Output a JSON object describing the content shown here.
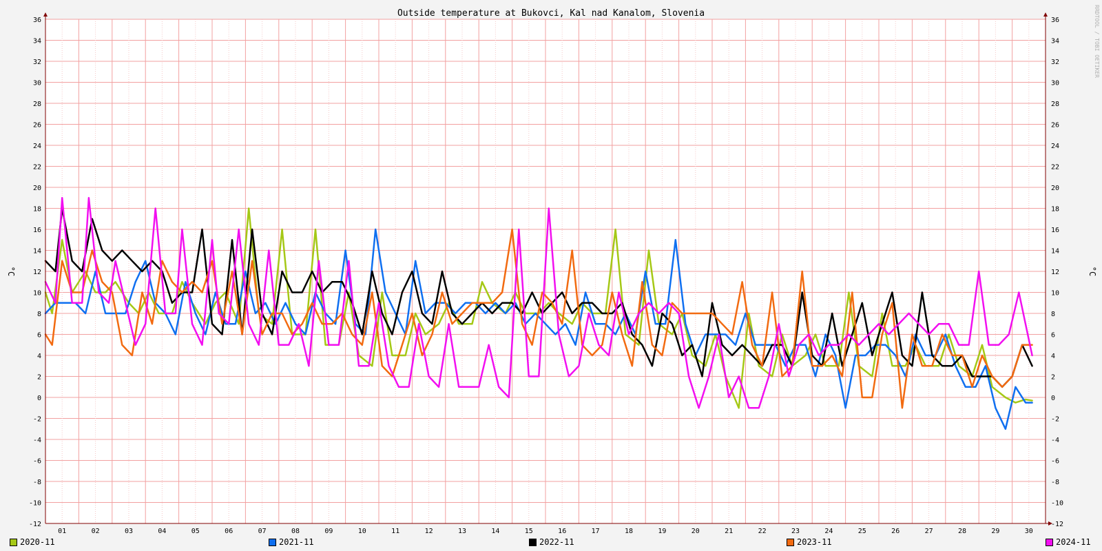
{
  "chart_data": {
    "type": "line",
    "title": "Outside temperature at Bukovci, Kal nad Kanalom, Slovenia",
    "ylabel": "°C",
    "ylabel_right": "°C",
    "watermark": "RRDTOOL / TOBI OETIKER",
    "ylim": [
      -12,
      36
    ],
    "yticks": [
      -12,
      -10,
      -8,
      -6,
      -4,
      -2,
      0,
      2,
      4,
      6,
      8,
      10,
      12,
      14,
      16,
      18,
      20,
      22,
      24,
      26,
      28,
      30,
      32,
      34,
      36
    ],
    "xlim": [
      1,
      31
    ],
    "xtick_labels": [
      "01",
      "02",
      "03",
      "04",
      "05",
      "06",
      "07",
      "08",
      "09",
      "10",
      "11",
      "12",
      "13",
      "14",
      "15",
      "16",
      "17",
      "18",
      "19",
      "20",
      "21",
      "22",
      "23",
      "24",
      "25",
      "26",
      "27",
      "28",
      "29",
      "30"
    ],
    "grid": true,
    "legend_position": "bottom",
    "series": [
      {
        "name": "2020-11",
        "color": "#a5c816",
        "x": [
          1,
          1.2,
          1.5,
          1.8,
          2.2,
          2.5,
          2.8,
          3.1,
          3.5,
          3.8,
          4.1,
          4.4,
          4.8,
          5.1,
          5.4,
          5.8,
          6.1,
          6.4,
          6.8,
          7.1,
          7.4,
          7.8,
          8.1,
          8.4,
          8.8,
          9.1,
          9.4,
          9.8,
          10.1,
          10.4,
          10.8,
          11.1,
          11.4,
          11.8,
          12.1,
          12.4,
          12.8,
          13.1,
          13.4,
          13.8,
          14.1,
          14.4,
          14.8,
          15.1,
          15.4,
          15.8,
          16.1,
          16.4,
          16.8,
          17.1,
          17.4,
          17.8,
          18.1,
          18.4,
          18.8,
          19.1,
          19.4,
          19.8,
          20.1,
          20.4,
          20.8,
          21.1,
          21.4,
          21.8,
          22.1,
          22.4,
          22.8,
          23.1,
          23.4,
          23.8,
          24.1,
          24.4,
          24.8,
          25.1,
          25.4,
          25.8,
          26.1,
          26.4,
          26.8,
          27.1,
          27.4,
          27.8,
          28.1,
          28.4,
          28.8,
          29.1,
          29.4,
          29.8,
          30.1,
          30.4,
          30.6
        ],
        "y": [
          10,
          8,
          15,
          10,
          12,
          10,
          10,
          11,
          9,
          8,
          10,
          8,
          8,
          11,
          9,
          7,
          9,
          10,
          7,
          18,
          8,
          7,
          16,
          6,
          6,
          16,
          5,
          5,
          10,
          4,
          3,
          10,
          4,
          4,
          8,
          6,
          7,
          9,
          7,
          7,
          11,
          9,
          8,
          10,
          8,
          8,
          9,
          8,
          7,
          9,
          8,
          8,
          16,
          6,
          5,
          14,
          7,
          6,
          8,
          4,
          3,
          6,
          2,
          -1,
          8,
          3,
          2,
          6,
          3,
          4,
          6,
          3,
          3,
          10,
          3,
          2,
          8,
          3,
          3,
          5,
          3,
          3,
          6,
          3,
          2,
          5,
          1,
          0,
          -0.5,
          -0.2,
          -0.3
        ]
      },
      {
        "name": "2021-11",
        "color": "#0f6ff0",
        "x": [
          1,
          1.3,
          1.6,
          1.9,
          2.2,
          2.5,
          2.8,
          3.1,
          3.4,
          3.7,
          4.0,
          4.3,
          4.6,
          4.9,
          5.2,
          5.5,
          5.8,
          6.1,
          6.4,
          6.7,
          7.0,
          7.3,
          7.6,
          7.9,
          8.2,
          8.5,
          8.8,
          9.1,
          9.4,
          9.7,
          10.0,
          10.3,
          10.6,
          10.9,
          11.2,
          11.5,
          11.8,
          12.1,
          12.4,
          12.7,
          13.0,
          13.3,
          13.6,
          13.9,
          14.2,
          14.5,
          14.8,
          15.1,
          15.4,
          15.7,
          16.0,
          16.3,
          16.6,
          16.9,
          17.2,
          17.5,
          17.8,
          18.1,
          18.4,
          18.7,
          19.0,
          19.3,
          19.6,
          19.9,
          20.2,
          20.5,
          20.8,
          21.1,
          21.4,
          21.7,
          22.0,
          22.3,
          22.6,
          22.9,
          23.2,
          23.5,
          23.8,
          24.1,
          24.4,
          24.7,
          25.0,
          25.3,
          25.6,
          25.9,
          26.2,
          26.5,
          26.8,
          27.1,
          27.4,
          27.7,
          28.0,
          28.3,
          28.6,
          28.9,
          29.2,
          29.5,
          29.8,
          30.1,
          30.4,
          30.6
        ],
        "y": [
          8,
          9,
          9,
          9,
          8,
          12,
          8,
          8,
          8,
          11,
          13,
          9,
          8,
          6,
          11,
          8,
          6,
          10,
          7,
          7,
          12,
          8,
          9,
          7,
          9,
          7,
          6,
          10,
          8,
          7,
          14,
          7,
          6,
          16,
          10,
          8,
          6,
          13,
          8,
          9,
          9,
          8,
          9,
          9,
          8,
          9,
          8,
          9,
          7,
          8,
          7,
          6,
          7,
          5,
          10,
          7,
          7,
          6,
          8,
          6,
          12,
          7,
          7,
          15,
          7,
          4,
          6,
          6,
          6,
          5,
          8,
          5,
          5,
          5,
          3,
          5,
          5,
          2,
          6,
          4,
          -1,
          4,
          4,
          5,
          5,
          4,
          2,
          6,
          4,
          4,
          6,
          3,
          1,
          1,
          3,
          -1,
          -3,
          1,
          -0.5,
          -0.5
        ]
      },
      {
        "name": "2022-11",
        "color": "#000000",
        "x": [
          1,
          1.3,
          1.5,
          1.8,
          2.1,
          2.4,
          2.7,
          3.0,
          3.3,
          3.6,
          3.9,
          4.2,
          4.5,
          4.8,
          5.1,
          5.4,
          5.7,
          6.0,
          6.3,
          6.6,
          6.9,
          7.2,
          7.5,
          7.8,
          8.1,
          8.4,
          8.7,
          9.0,
          9.3,
          9.6,
          9.9,
          10.2,
          10.5,
          10.8,
          11.1,
          11.4,
          11.7,
          12.0,
          12.3,
          12.6,
          12.9,
          13.2,
          13.5,
          13.8,
          14.1,
          14.4,
          14.7,
          15.0,
          15.3,
          15.6,
          15.9,
          16.2,
          16.5,
          16.8,
          17.1,
          17.4,
          17.7,
          18.0,
          18.3,
          18.6,
          18.9,
          19.2,
          19.5,
          19.8,
          20.1,
          20.4,
          20.7,
          21.0,
          21.3,
          21.6,
          21.9,
          22.2,
          22.5,
          22.8,
          23.1,
          23.4,
          23.7,
          24.0,
          24.3,
          24.6,
          24.9,
          25.2,
          25.5,
          25.8,
          26.1,
          26.4,
          26.7,
          27.0,
          27.3,
          27.6,
          27.9,
          28.2,
          28.5,
          28.8,
          29.1,
          29.4,
          29.7,
          30.0,
          30.3,
          30.6
        ],
        "y": [
          13,
          12,
          18,
          13,
          12,
          17,
          14,
          13,
          14,
          13,
          12,
          13,
          12,
          9,
          10,
          10,
          16,
          7,
          6,
          15,
          6,
          16,
          8,
          6,
          12,
          10,
          10,
          12,
          10,
          11,
          11,
          9,
          6,
          12,
          8,
          6,
          10,
          12,
          8,
          7,
          12,
          8,
          7,
          8,
          9,
          8,
          9,
          9,
          8,
          10,
          8,
          9,
          10,
          8,
          9,
          9,
          8,
          8,
          9,
          6,
          5,
          3,
          8,
          7,
          4,
          5,
          2,
          9,
          5,
          4,
          5,
          4,
          3,
          5,
          5,
          3,
          10,
          4,
          3,
          8,
          3,
          6,
          9,
          4,
          7,
          10,
          4,
          3,
          10,
          4,
          3,
          3,
          4,
          2,
          2,
          2,
          1,
          2,
          5,
          3
        ]
      },
      {
        "name": "2023-11",
        "color": "#f26a10",
        "x": [
          1,
          1.2,
          1.5,
          1.8,
          2.1,
          2.4,
          2.7,
          3.0,
          3.3,
          3.6,
          3.9,
          4.2,
          4.5,
          4.8,
          5.1,
          5.4,
          5.7,
          6.0,
          6.3,
          6.6,
          6.9,
          7.2,
          7.5,
          7.8,
          8.1,
          8.4,
          8.7,
          9.0,
          9.3,
          9.6,
          9.9,
          10.2,
          10.5,
          10.8,
          11.1,
          11.4,
          11.7,
          12.0,
          12.3,
          12.6,
          12.9,
          13.2,
          13.5,
          13.8,
          14.1,
          14.4,
          14.7,
          15.0,
          15.3,
          15.6,
          15.9,
          16.2,
          16.5,
          16.8,
          17.1,
          17.4,
          17.7,
          18.0,
          18.3,
          18.6,
          18.9,
          19.2,
          19.5,
          19.8,
          20.1,
          20.4,
          20.7,
          21.0,
          21.3,
          21.6,
          21.9,
          22.2,
          22.5,
          22.8,
          23.1,
          23.4,
          23.7,
          24.0,
          24.3,
          24.6,
          24.9,
          25.2,
          25.5,
          25.8,
          26.1,
          26.4,
          26.7,
          27.0,
          27.3,
          27.6,
          27.9,
          28.2,
          28.5,
          28.8,
          29.1,
          29.4,
          29.7,
          30.0,
          30.3,
          30.6
        ],
        "y": [
          6,
          5,
          13,
          10,
          10,
          14,
          11,
          10,
          5,
          4,
          10,
          7,
          13,
          11,
          10,
          11,
          10,
          13,
          7,
          12,
          6,
          13,
          6,
          8,
          8,
          6,
          7,
          9,
          7,
          7,
          8,
          6,
          5,
          10,
          3,
          2,
          5,
          8,
          4,
          6,
          10,
          7,
          8,
          9,
          9,
          9,
          10,
          16,
          7,
          5,
          10,
          9,
          7,
          14,
          5,
          4,
          5,
          10,
          6,
          3,
          11,
          5,
          4,
          9,
          8,
          8,
          8,
          8,
          7,
          6,
          11,
          5,
          3,
          10,
          2,
          3,
          12,
          3,
          3,
          4,
          2,
          10,
          0,
          0,
          6,
          9,
          -1,
          6,
          3,
          3,
          6,
          4,
          4,
          1,
          4,
          2,
          1,
          2,
          5,
          5
        ]
      },
      {
        "name": "2024-11",
        "color": "#f20ff0",
        "x": [
          1,
          1.3,
          1.5,
          1.8,
          2.1,
          2.3,
          2.6,
          2.9,
          3.1,
          3.4,
          3.7,
          4.0,
          4.3,
          4.6,
          4.9,
          5.1,
          5.4,
          5.7,
          6.0,
          6.2,
          6.5,
          6.8,
          7.1,
          7.4,
          7.7,
          8.0,
          8.3,
          8.6,
          8.9,
          9.2,
          9.5,
          9.8,
          10.1,
          10.4,
          10.7,
          11.0,
          11.3,
          11.6,
          11.9,
          12.2,
          12.5,
          12.8,
          13.1,
          13.4,
          13.7,
          14.0,
          14.3,
          14.6,
          14.9,
          15.2,
          15.5,
          15.8,
          16.1,
          16.4,
          16.7,
          17.0,
          17.3,
          17.6,
          17.9,
          18.2,
          18.5,
          18.8,
          19.1,
          19.4,
          19.7,
          20.0,
          20.3,
          20.6,
          20.9,
          21.2,
          21.5,
          21.8,
          22.1,
          22.4,
          22.7,
          23.0,
          23.3,
          23.6,
          23.9,
          24.2,
          24.5,
          24.8,
          25.1,
          25.4,
          25.7,
          26.0,
          26.3,
          26.6,
          26.9,
          27.2,
          27.5,
          27.8,
          28.1,
          28.4,
          28.7,
          29.0,
          29.3,
          29.6,
          29.9,
          30.2,
          30.6
        ],
        "y": [
          11,
          9,
          19,
          9,
          9,
          19,
          10,
          9,
          13,
          9,
          5,
          7,
          18,
          8,
          8,
          16,
          7,
          5,
          15,
          8,
          7,
          16,
          7,
          5,
          14,
          5,
          5,
          7,
          3,
          13,
          5,
          5,
          13,
          3,
          3,
          9,
          3,
          1,
          1,
          7,
          2,
          1,
          7,
          1,
          1,
          1,
          5,
          1,
          0,
          16,
          2,
          2,
          18,
          6,
          2,
          3,
          8,
          5,
          4,
          10,
          6,
          8,
          9,
          8,
          9,
          8,
          2,
          -1,
          2,
          6,
          0,
          2,
          -1,
          -1,
          2,
          7,
          2,
          5,
          6,
          4,
          5,
          5,
          6,
          5,
          6,
          7,
          6,
          7,
          8,
          7,
          6,
          7,
          7,
          5,
          5,
          12,
          5,
          5,
          6,
          10,
          4
        ]
      }
    ]
  },
  "legend": [
    {
      "label": "2020-11",
      "color": "#a5c816"
    },
    {
      "label": "2021-11",
      "color": "#0f6ff0"
    },
    {
      "label": "2022-11",
      "color": "#000000"
    },
    {
      "label": "2023-11",
      "color": "#f26a10"
    },
    {
      "label": "2024-11",
      "color": "#f20ff0"
    }
  ]
}
